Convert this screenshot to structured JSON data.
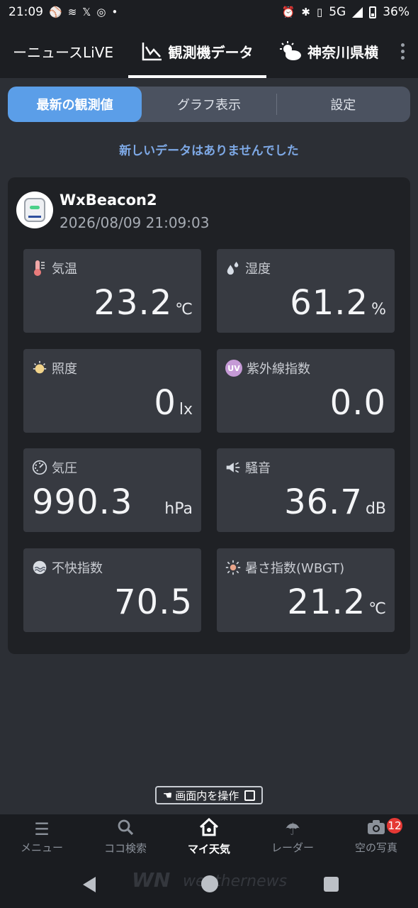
{
  "status_bar": {
    "time": "21:09",
    "network": "5G",
    "battery": "36%"
  },
  "top_nav": {
    "tabs": [
      {
        "label": "ーニュースLiVE"
      },
      {
        "label": "観測機データ"
      },
      {
        "label": "神奈川県横"
      }
    ]
  },
  "segment": {
    "items": [
      {
        "label": "最新の観測値"
      },
      {
        "label": "グラフ表示"
      },
      {
        "label": "設定"
      }
    ]
  },
  "notice": "新しいデータはありませんでした",
  "device": {
    "name": "WxBeacon2",
    "timestamp": "2026/08/09 21:09:03"
  },
  "readings": [
    {
      "label": "気温",
      "value": "23.2",
      "unit": "℃",
      "icon": "thermometer-icon"
    },
    {
      "label": "湿度",
      "value": "61.2",
      "unit": "%",
      "icon": "droplet-icon"
    },
    {
      "label": "照度",
      "value": "0",
      "unit": "lx",
      "icon": "bulb-icon"
    },
    {
      "label": "紫外線指数",
      "value": "0.0",
      "unit": "",
      "icon_text": "UV"
    },
    {
      "label": "気圧",
      "value": "990.3",
      "unit": "hPa",
      "icon": "gauge-icon"
    },
    {
      "label": "騒音",
      "value": "36.7",
      "unit": "dB",
      "icon": "speaker-icon"
    },
    {
      "label": "不快指数",
      "value": "70.5",
      "unit": "",
      "icon": "discomfort-icon"
    },
    {
      "label": "暑さ指数(WBGT)",
      "value": "21.2",
      "unit": "℃",
      "icon": "sun-icon"
    }
  ],
  "operate": {
    "label": "画面内を操作"
  },
  "bottom_nav": {
    "items": [
      {
        "label": "メニュー"
      },
      {
        "label": "ココ検索"
      },
      {
        "label": "マイ天気"
      },
      {
        "label": "レーダー"
      },
      {
        "label": "空の写真",
        "badge": "12"
      }
    ]
  },
  "watermark": "weathernews",
  "watermark_logo": "WN"
}
